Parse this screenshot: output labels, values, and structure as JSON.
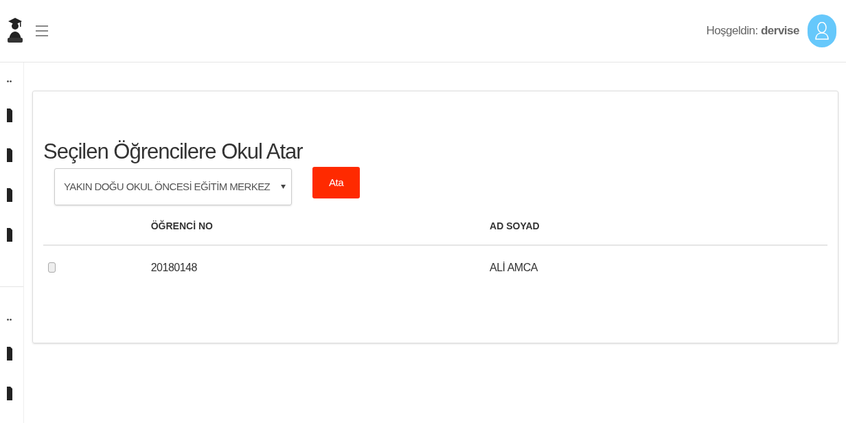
{
  "header": {
    "greeting": "Hoşgeldin:",
    "user": "dervise"
  },
  "panel": {
    "title": "Seçilen Öğrencilere Okul Atar",
    "school_select": {
      "value": "YAKIN DOĞU OKUL ÖNCESİ EĞİTİM MERKEZ"
    },
    "assign_button": "Ata",
    "table": {
      "columns": [
        "ÖĞRENCİ NO",
        "AD SOYAD"
      ],
      "rows": [
        {
          "checked": false,
          "cells": [
            "20180148",
            "ALİ AMCA"
          ]
        }
      ]
    }
  }
}
